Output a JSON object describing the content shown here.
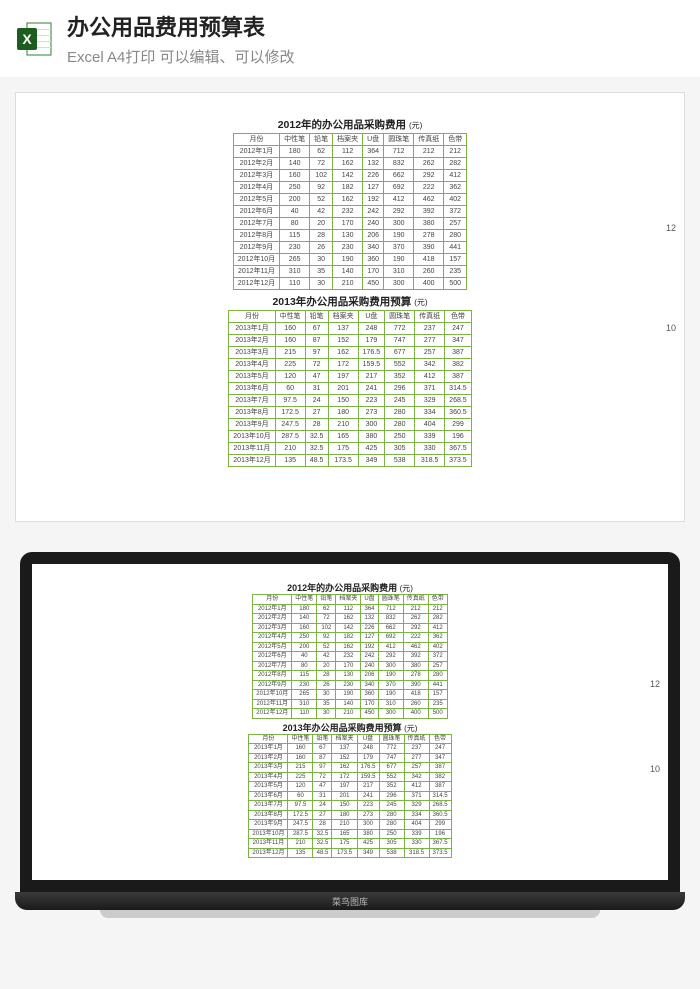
{
  "header": {
    "title": "办公用品费用预算表",
    "subtitle": "Excel A4打印 可以编辑、可以修改"
  },
  "side_numbers": {
    "a": "12",
    "b": "10"
  },
  "watermark": "菜鸟图库",
  "chart_data": [
    {
      "type": "table",
      "title": "2012年的办公用品采购费用",
      "unit": "(元)",
      "columns": [
        "月份",
        "中性笔",
        "铅笔",
        "档案夹",
        "U盘",
        "圆珠笔",
        "传真纸",
        "色带"
      ],
      "rows": [
        [
          "2012年1月",
          180,
          62,
          112,
          364,
          712,
          212,
          212
        ],
        [
          "2012年2月",
          140,
          72,
          162,
          132,
          832,
          262,
          282
        ],
        [
          "2012年3月",
          160,
          102,
          142,
          226,
          662,
          292,
          412
        ],
        [
          "2012年4月",
          250,
          92,
          182,
          127,
          692,
          222,
          362
        ],
        [
          "2012年5月",
          200,
          52,
          162,
          192,
          412,
          462,
          402
        ],
        [
          "2012年6月",
          40,
          42,
          232,
          242,
          292,
          392,
          372
        ],
        [
          "2012年7月",
          80,
          20,
          170,
          240,
          300,
          380,
          257
        ],
        [
          "2012年8月",
          115,
          28,
          130,
          206,
          190,
          278,
          280
        ],
        [
          "2012年9月",
          230,
          26,
          230,
          340,
          370,
          390,
          441
        ],
        [
          "2012年10月",
          265,
          30,
          190,
          360,
          190,
          418,
          157
        ],
        [
          "2012年11月",
          310,
          35,
          140,
          170,
          310,
          260,
          235
        ],
        [
          "2012年12月",
          110,
          30,
          210,
          450,
          300,
          400,
          500
        ]
      ]
    },
    {
      "type": "table",
      "title": "2013年办公用品采购费用预算",
      "unit": "(元)",
      "columns": [
        "月份",
        "中性笔",
        "铅笔",
        "档案夹",
        "U盘",
        "圆珠笔",
        "传真纸",
        "色带"
      ],
      "rows": [
        [
          "2013年1月",
          160,
          67,
          137,
          248,
          772,
          237,
          247
        ],
        [
          "2013年2月",
          160,
          87,
          152,
          179,
          747,
          277,
          347
        ],
        [
          "2013年3月",
          215,
          97,
          162,
          "176.5",
          677,
          257,
          387
        ],
        [
          "2013年4月",
          225,
          72,
          172,
          "159.5",
          552,
          342,
          382
        ],
        [
          "2013年5月",
          120,
          47,
          197,
          217,
          352,
          412,
          387
        ],
        [
          "2013年6月",
          60,
          31,
          201,
          241,
          296,
          371,
          "314.5"
        ],
        [
          "2013年7月",
          "97.5",
          24,
          150,
          223,
          245,
          329,
          "268.5"
        ],
        [
          "2013年8月",
          "172.5",
          27,
          180,
          273,
          280,
          334,
          "360.5"
        ],
        [
          "2013年9月",
          "247.5",
          28,
          210,
          300,
          280,
          404,
          299
        ],
        [
          "2013年10月",
          "287.5",
          "32.5",
          165,
          380,
          250,
          339,
          196
        ],
        [
          "2013年11月",
          210,
          "32.5",
          175,
          425,
          305,
          330,
          "367.5"
        ],
        [
          "2013年12月",
          135,
          "48.5",
          "173.5",
          349,
          538,
          "318.5",
          "373.5"
        ]
      ]
    }
  ]
}
